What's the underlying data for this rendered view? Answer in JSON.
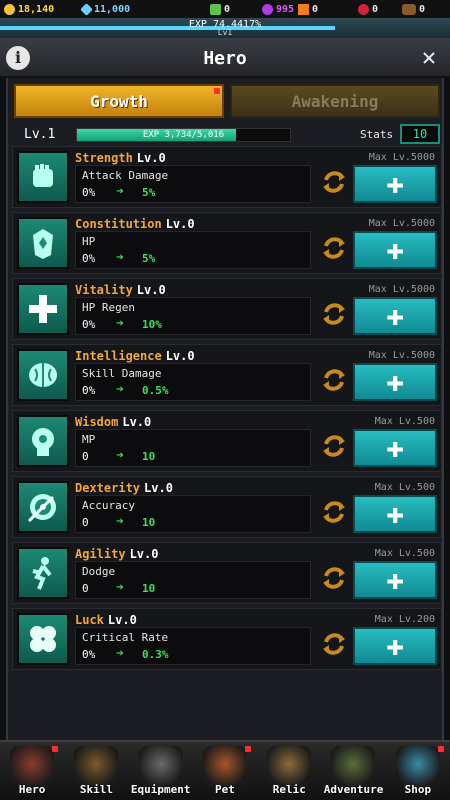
{
  "resources": {
    "gold": "18,140",
    "gem": "11,000",
    "green": "0",
    "purple": "995",
    "orange": "0",
    "red": "0",
    "wood": "0"
  },
  "exp": {
    "text": "EXP 74.4417%",
    "level_label": "Lv1",
    "fill_percent": 74.4417
  },
  "header": {
    "title": "Hero",
    "info_icon": "info-icon",
    "close_icon": "close-icon"
  },
  "tabs": [
    {
      "label": "Growth",
      "active": true
    },
    {
      "label": "Awakening",
      "active": false
    }
  ],
  "level": {
    "label": "Lv.1",
    "exp_text": "EXP 3,734/5,016",
    "stats_label": "Stats",
    "stats_value": "10"
  },
  "stats": [
    {
      "name": "Strength",
      "level": "Lv.0",
      "max": "Max Lv.5000",
      "stat": "Attack Damage",
      "from": "0%",
      "to": "5%",
      "icon": "fist-icon"
    },
    {
      "name": "Constitution",
      "level": "Lv.0",
      "max": "Max Lv.5000",
      "stat": "HP",
      "from": "0%",
      "to": "5%",
      "icon": "armor-icon"
    },
    {
      "name": "Vitality",
      "level": "Lv.0",
      "max": "Max Lv.5000",
      "stat": "HP Regen",
      "from": "0%",
      "to": "10%",
      "icon": "heal-cross-icon"
    },
    {
      "name": "Intelligence",
      "level": "Lv.0",
      "max": "Max Lv.5000",
      "stat": "Skill Damage",
      "from": "0%",
      "to": "0.5%",
      "icon": "brain-icon"
    },
    {
      "name": "Wisdom",
      "level": "Lv.0",
      "max": "Max Lv.500",
      "stat": "MP",
      "from": "0",
      "to": "10",
      "icon": "head-icon"
    },
    {
      "name": "Dexterity",
      "level": "Lv.0",
      "max": "Max Lv.500",
      "stat": "Accuracy",
      "from": "0",
      "to": "10",
      "icon": "target-icon"
    },
    {
      "name": "Agility",
      "level": "Lv.0",
      "max": "Max Lv.500",
      "stat": "Dodge",
      "from": "0",
      "to": "10",
      "icon": "runner-icon"
    },
    {
      "name": "Luck",
      "level": "Lv.0",
      "max": "Max Lv.200",
      "stat": "Critical Rate",
      "from": "0%",
      "to": "0.3%",
      "icon": "clover-icon"
    }
  ],
  "nav": [
    {
      "label": "Hero",
      "icon": "hero-icon"
    },
    {
      "label": "Skill",
      "icon": "skill-icon"
    },
    {
      "label": "Equipment",
      "icon": "equipment-icon"
    },
    {
      "label": "Pet",
      "icon": "pet-icon"
    },
    {
      "label": "Relic",
      "icon": "relic-icon"
    },
    {
      "label": "Adventure",
      "icon": "adventure-icon"
    },
    {
      "label": "Shop",
      "icon": "shop-icon"
    }
  ],
  "colors": {
    "accent_orange": "#f0b529",
    "teal": "#27bcc0",
    "green_arrow": "#3fe05a",
    "stat_name": "#f3a63c"
  }
}
